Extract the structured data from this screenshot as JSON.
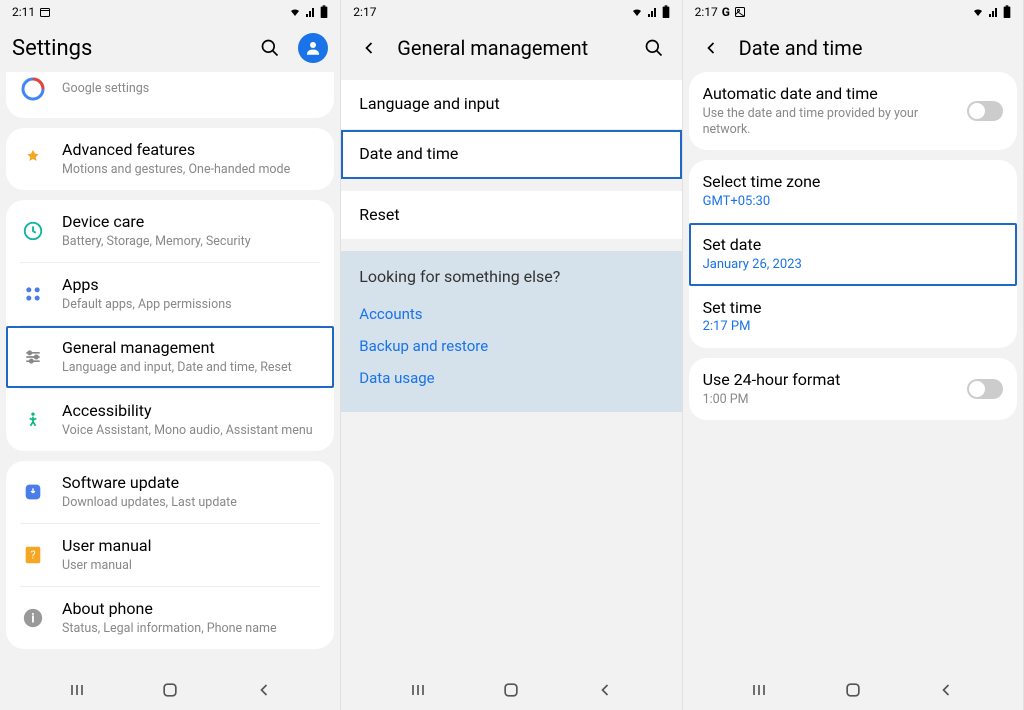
{
  "screen1": {
    "time": "2:11",
    "header": "Settings",
    "google_sub": "Google settings",
    "items": [
      {
        "title": "Advanced features",
        "sub": "Motions and gestures, One-handed mode",
        "icon": "advanced"
      },
      {
        "title": "Device care",
        "sub": "Battery, Storage, Memory, Security",
        "icon": "device"
      },
      {
        "title": "Apps",
        "sub": "Default apps, App permissions",
        "icon": "apps"
      },
      {
        "title": "General management",
        "sub": "Language and input, Date and time, Reset",
        "icon": "general",
        "highlight": true
      },
      {
        "title": "Accessibility",
        "sub": "Voice Assistant, Mono audio, Assistant menu",
        "icon": "access"
      },
      {
        "title": "Software update",
        "sub": "Download updates, Last update",
        "icon": "update"
      },
      {
        "title": "User manual",
        "sub": "User manual",
        "icon": "manual"
      },
      {
        "title": "About phone",
        "sub": "Status, Legal information, Phone name",
        "icon": "about"
      }
    ]
  },
  "screen2": {
    "time": "2:17",
    "header": "General management",
    "items": [
      {
        "title": "Language and input"
      },
      {
        "title": "Date and time",
        "highlight": true
      },
      {
        "title": "Reset"
      }
    ],
    "looking": {
      "title": "Looking for something else?",
      "links": [
        "Accounts",
        "Backup and restore",
        "Data usage"
      ]
    }
  },
  "screen3": {
    "time": "2:17",
    "status_extra": "G",
    "header": "Date and time",
    "items": [
      {
        "title": "Automatic date and time",
        "sub": "Use the date and time provided by your network.",
        "toggle": true
      },
      {
        "title": "Select time zone",
        "sub": "GMT+05:30",
        "blue": true
      },
      {
        "title": "Set date",
        "sub": "January 26, 2023",
        "blue": true,
        "highlight": true
      },
      {
        "title": "Set time",
        "sub": "2:17 PM",
        "blue": true
      },
      {
        "title": "Use 24-hour format",
        "sub": "1:00 PM",
        "toggle": true
      }
    ]
  }
}
